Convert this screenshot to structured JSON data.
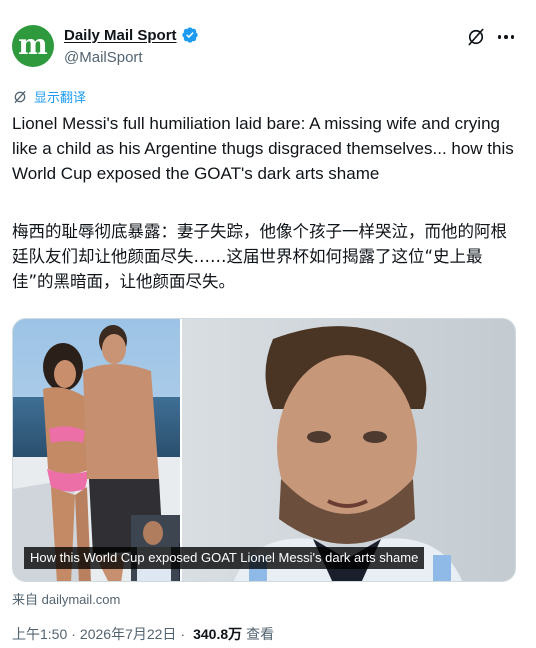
{
  "account": {
    "display_name": "Daily Mail Sport",
    "handle": "@MailSport",
    "avatar_glyph": "m",
    "verified": true,
    "brand_color": "#2e9a3d",
    "verified_color": "#1d9bf0"
  },
  "icons": {
    "grok": "grok-icon",
    "more": "more-icon",
    "translate": "translate-icon",
    "verified": "verified-badge-icon"
  },
  "translate_label": "显示翻译",
  "tweet": {
    "text_en": "Lionel Messi's full humiliation laid bare: A missing wife and crying like a child as his Argentine thugs disgraced themselves... how this World Cup exposed the GOAT's dark arts shame",
    "text_zh": "梅西的耻辱彻底暴露：妻子失踪，他像个孩子一样哭泣，而他的阿根廷队友们却让他颜面尽失……这届世界杯如何揭露了这位“史上最佳”的黑暗面，让他颜面尽失。"
  },
  "media": {
    "caption": "How this World Cup exposed GOAT Lionel Messi's dark arts shame"
  },
  "source": "来自 dailymail.com",
  "meta": {
    "time": "上午1:50",
    "separator": "·",
    "date": "2026年7月22日",
    "views": "340.8万",
    "views_label": "查看"
  },
  "colors": {
    "link": "#1d9bf0",
    "secondary_text": "#536471",
    "primary_text": "#0f1419"
  }
}
